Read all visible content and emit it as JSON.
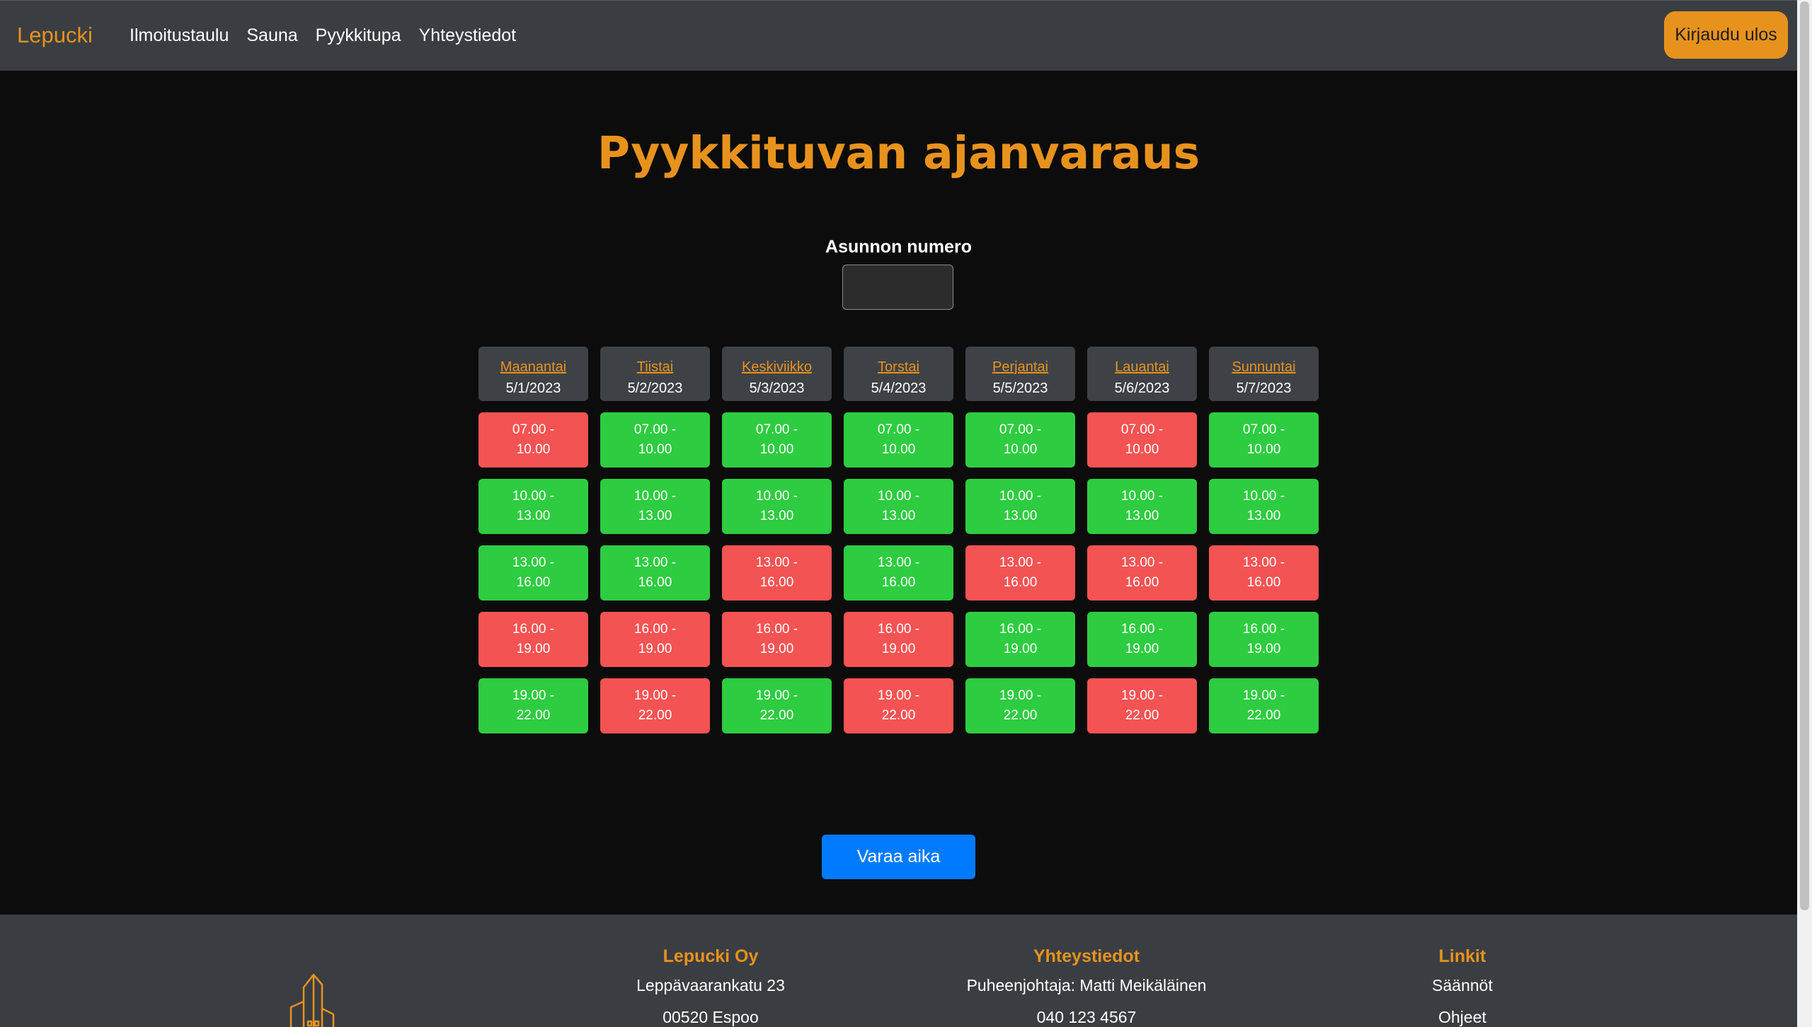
{
  "nav": {
    "brand": "Lepucki",
    "links": [
      "Ilmoitustaulu",
      "Sauna",
      "Pyykkitupa",
      "Yhteystiedot"
    ],
    "logout_label": "Kirjaudu ulos"
  },
  "page_title": "Pyykkituvan ajanvaraus",
  "form": {
    "label": "Asunnon numero",
    "value": "",
    "submit_label": "Varaa aika"
  },
  "booking": {
    "times": [
      "07.00 - 10.00",
      "10.00 - 13.00",
      "13.00 - 16.00",
      "16.00 - 19.00",
      "19.00 - 22.00"
    ],
    "days": [
      {
        "name": "Maanantai",
        "date": "5/1/2023",
        "free": [
          false,
          true,
          true,
          false,
          true
        ]
      },
      {
        "name": "Tiistai",
        "date": "5/2/2023",
        "free": [
          true,
          true,
          true,
          false,
          false
        ]
      },
      {
        "name": "Keskiviikko",
        "date": "5/3/2023",
        "free": [
          true,
          true,
          false,
          false,
          true
        ]
      },
      {
        "name": "Torstai",
        "date": "5/4/2023",
        "free": [
          true,
          true,
          true,
          false,
          false
        ]
      },
      {
        "name": "Perjantai",
        "date": "5/5/2023",
        "free": [
          true,
          true,
          false,
          true,
          true
        ]
      },
      {
        "name": "Lauantai",
        "date": "5/6/2023",
        "free": [
          false,
          true,
          false,
          true,
          false
        ]
      },
      {
        "name": "Sunnuntai",
        "date": "5/7/2023",
        "free": [
          true,
          true,
          false,
          true,
          true
        ]
      }
    ]
  },
  "footer": {
    "logo_icon": "building-logo-icon",
    "columns": [
      {
        "heading": "Lepucki Oy",
        "lines": [
          "Leppävaarankatu 23",
          "00520 Espoo"
        ]
      },
      {
        "heading": "Yhteystiedot",
        "lines": [
          "Puheenjohtaja: Matti Meikäläinen",
          "040 123 4567"
        ]
      },
      {
        "heading": "Linkit",
        "lines": [
          "Säännöt",
          "Ohjeet"
        ]
      }
    ]
  },
  "colors": {
    "accent": "#e8921e",
    "free": "#2ecc40",
    "booked": "#f45353",
    "primary": "#007bff",
    "bar_background": "#3a3e42",
    "page_background": "#0c0c0c"
  }
}
